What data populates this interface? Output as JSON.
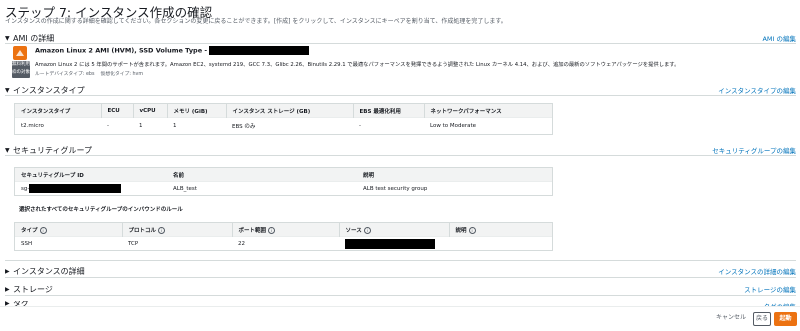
{
  "page": {
    "title": "ステップ 7: インスタンス作成の確認",
    "subtitle": "インスタンスの作成に関する詳細を確認してください。各セクションの変更に戻ることができます。[作成] をクリックして、インスタンスにキーペアを割り当て、作成処理を完了します。"
  },
  "ami": {
    "section_label": "AMI の詳細",
    "edit_link": "AMI の編集",
    "name": "Amazon Linux 2 AMI (HVM), SSD Volume Type -",
    "badge": "無料利用枠の対象",
    "description": "Amazon Linux 2 には 5 年間のサポートが含まれます。Amazon EC2、systemd 219、GCC 7.3、Glibc 2.26、Binutils 2.29.1 で最適なパフォーマンスを発揮できるよう調整された Linux カーネル 4.14、および、追加の最新のソフトウェアパッケージを提供します。",
    "meta": "ルートデバイスタイプ: ebs    仮想化タイプ: hvm"
  },
  "instance_type": {
    "section_label": "インスタンスタイプ",
    "edit_link": "インスタンスタイプの編集",
    "headers": [
      "インスタンスタイプ",
      "ECU",
      "vCPU",
      "メモリ (GiB)",
      "インスタンス ストレージ (GB)",
      "EBS 最適化利用",
      "ネットワークパフォーマンス"
    ],
    "row": [
      "t2.micro",
      "-",
      "1",
      "1",
      "EBS のみ",
      "-",
      "Low to Moderate"
    ]
  },
  "security_groups": {
    "section_label": "セキュリティグループ",
    "edit_link": "セキュリティグループの編集",
    "headers": [
      "セキュリティグループ ID",
      "名前",
      "説明"
    ],
    "row": {
      "id_prefix": "sg-",
      "name": "ALB_test",
      "description": "ALB test security group"
    },
    "rules_caption": "選択されたすべてのセキュリティグループのインバウンドのルール",
    "rule_headers": [
      "タイプ",
      "プロトコル",
      "ポート範囲",
      "ソース",
      "説明"
    ],
    "rule_row": [
      "SSH",
      "TCP",
      "22",
      "",
      ""
    ]
  },
  "instance_details": {
    "section_label": "インスタンスの詳細",
    "edit_link": "インスタンスの詳細の編集"
  },
  "storage": {
    "section_label": "ストレージ",
    "edit_link": "ストレージの編集"
  },
  "tags": {
    "section_label": "タグ",
    "edit_link": "タグの編集"
  },
  "footer": {
    "cancel": "キャンセル",
    "back": "戻る",
    "launch": "起動"
  },
  "colors": {
    "link": "#0073bb",
    "primary": "#ec7211",
    "badge_bg": "#545b64",
    "ami_icon": "#ec7211"
  }
}
